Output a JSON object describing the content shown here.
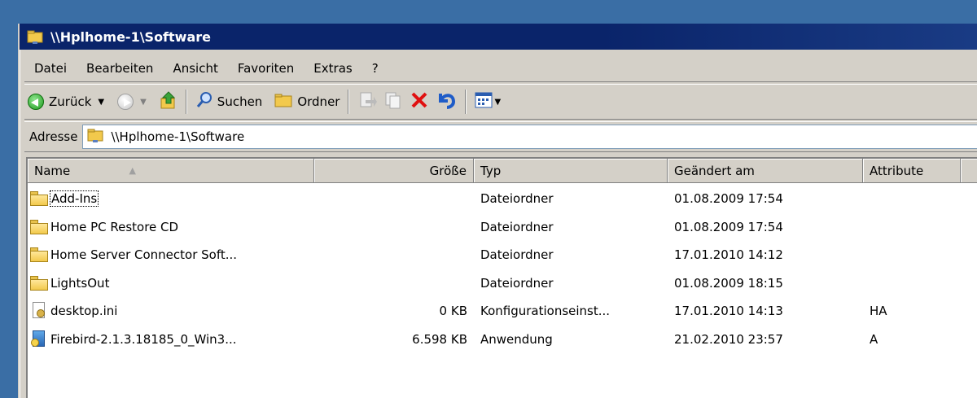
{
  "window": {
    "title": "\\\\Hplhome-1\\Software"
  },
  "menu": {
    "items": [
      {
        "label": "Datei"
      },
      {
        "label": "Bearbeiten"
      },
      {
        "label": "Ansicht"
      },
      {
        "label": "Favoriten"
      },
      {
        "label": "Extras"
      },
      {
        "label": "?"
      }
    ]
  },
  "toolbar": {
    "back_label": "Zurück",
    "search_label": "Suchen",
    "folders_label": "Ordner"
  },
  "address": {
    "label": "Adresse",
    "value": "\\\\Hplhome-1\\Software"
  },
  "columns": {
    "name": "Name",
    "size": "Größe",
    "type": "Typ",
    "modified": "Geändert am",
    "attributes": "Attribute"
  },
  "files": [
    {
      "name": "Add-Ins",
      "size": "",
      "type": "Dateiordner",
      "modified": "01.08.2009 17:54",
      "attributes": "",
      "icon": "folder-icon"
    },
    {
      "name": "Home PC Restore CD",
      "size": "",
      "type": "Dateiordner",
      "modified": "01.08.2009 17:54",
      "attributes": "",
      "icon": "folder-icon"
    },
    {
      "name": "Home Server Connector Soft...",
      "size": "",
      "type": "Dateiordner",
      "modified": "17.01.2010 14:12",
      "attributes": "",
      "icon": "folder-icon"
    },
    {
      "name": "LightsOut",
      "size": "",
      "type": "Dateiordner",
      "modified": "01.08.2009 18:15",
      "attributes": "",
      "icon": "folder-icon"
    },
    {
      "name": "desktop.ini",
      "size": "0 KB",
      "type": "Konfigurationseinst...",
      "modified": "17.01.2010 14:13",
      "attributes": "HA",
      "icon": "config-file-icon"
    },
    {
      "name": "Firebird-2.1.3.18185_0_Win3...",
      "size": "6.598 KB",
      "type": "Anwendung",
      "modified": "21.02.2010 23:57",
      "attributes": "A",
      "icon": "installer-icon"
    }
  ]
}
